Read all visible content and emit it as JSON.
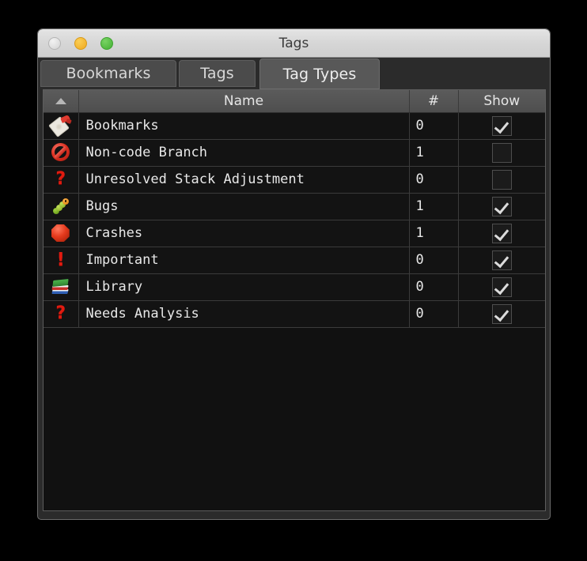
{
  "window": {
    "title": "Tags",
    "traffic_lights": [
      "close-button",
      "minimize-button",
      "maximize-button"
    ]
  },
  "tabs": [
    {
      "label": "Bookmarks",
      "active": false
    },
    {
      "label": "Tags",
      "active": false
    },
    {
      "label": "Tag Types",
      "active": true
    }
  ],
  "table": {
    "columns": [
      {
        "key": "icon",
        "label": "",
        "sort_indicator": "ascending"
      },
      {
        "key": "name",
        "label": "Name"
      },
      {
        "key": "count",
        "label": "#"
      },
      {
        "key": "show",
        "label": "Show"
      }
    ],
    "rows": [
      {
        "icon": "tag-icon",
        "name": "Bookmarks",
        "count": "0",
        "show": true
      },
      {
        "icon": "no-entry-icon",
        "name": "Non-code Branch",
        "count": "1",
        "show": false
      },
      {
        "icon": "question-mark-icon",
        "name": "Unresolved Stack Adjustment",
        "count": "0",
        "show": false
      },
      {
        "icon": "bug-icon",
        "name": "Bugs",
        "count": "1",
        "show": true
      },
      {
        "icon": "red-octagon-icon",
        "name": "Crashes",
        "count": "1",
        "show": true
      },
      {
        "icon": "exclamation-icon",
        "name": "Important",
        "count": "0",
        "show": true
      },
      {
        "icon": "books-icon",
        "name": "Library",
        "count": "0",
        "show": true
      },
      {
        "icon": "question-mark-icon",
        "name": "Needs Analysis",
        "count": "0",
        "show": true
      }
    ]
  },
  "glyphs": {
    "question": "?",
    "exclamation": "!"
  },
  "colors": {
    "desktop_background": "#000000",
    "titlebar": "#d9d9d9",
    "window_chrome": "#2b2b2b",
    "tab_inactive": "#4b4b4b",
    "tab_active": "#585858",
    "table_header": "#555555",
    "row_background": "#131313",
    "text": "#e8e8e8",
    "icon_red": "#e01b10"
  }
}
